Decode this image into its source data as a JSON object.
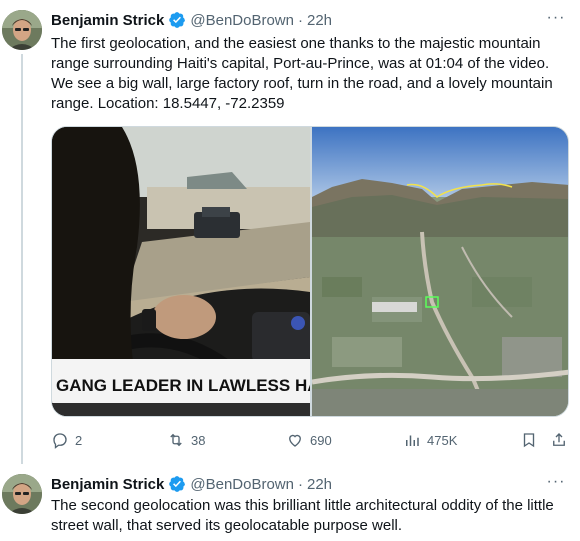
{
  "tweets": [
    {
      "author_name": "Benjamin Strick",
      "handle": "@BenDoBrown",
      "separator": "·",
      "time": "22h",
      "more_label": "···",
      "text": "The first geolocation, and the easiest one thanks to the majestic mountain range surrounding Haiti's capital, Port-au-Prince, was at 01:04 of the video. We see a big wall, large factory roof, turn in the road, and a lovely mountain range. Location: 18.5447, -72.2359",
      "media_caption": "GANG LEADER IN LAWLESS HAITIAN TERI",
      "replies": "2",
      "reposts": "38",
      "likes": "690",
      "views": "475K"
    },
    {
      "author_name": "Benjamin Strick",
      "handle": "@BenDoBrown",
      "separator": "·",
      "time": "22h",
      "more_label": "···",
      "text": "The second geolocation was this brilliant little architectural oddity of the little street wall, that served its geolocatable purpose well."
    }
  ],
  "icons": {
    "verified": "verified-badge-icon",
    "reply": "reply-icon",
    "repost": "repost-icon",
    "like": "heart-icon",
    "views": "views-icon",
    "bookmark": "bookmark-icon",
    "share": "share-icon",
    "more": "more-icon"
  },
  "colors": {
    "verified": "#1d9bf0",
    "muted": "#536471",
    "text": "#0f1419",
    "border": "#cfd9de"
  }
}
